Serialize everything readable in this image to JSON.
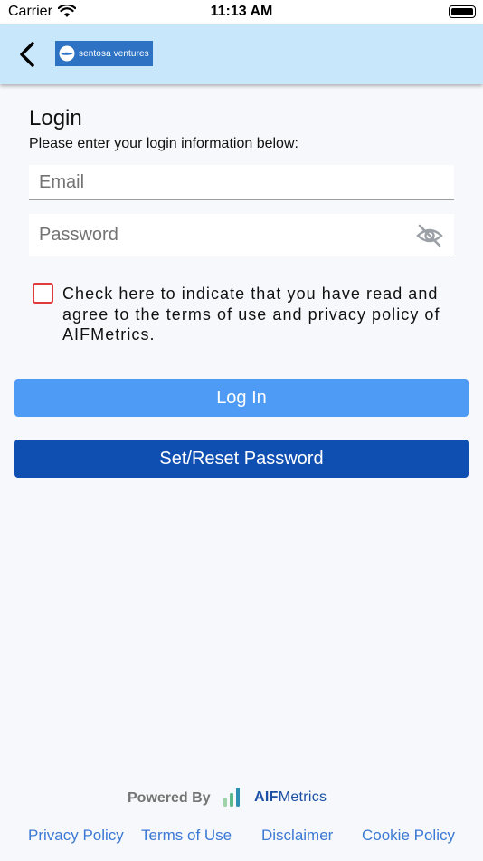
{
  "status_bar": {
    "carrier": "Carrier",
    "time": "11:13 AM"
  },
  "header": {
    "brand_name": "sentosa ventures",
    "back_icon": "chevron-left-icon",
    "background": "#c8e7fb"
  },
  "login": {
    "title": "Login",
    "subtitle": "Please enter your login information below:",
    "email_placeholder": "Email",
    "email_value": "",
    "password_placeholder": "Password",
    "password_value": "",
    "password_toggle_icon": "eye-off-icon",
    "terms_checked": false,
    "terms_text": "Check here to indicate that you have read and agree to the terms of use and privacy policy of AIFMetrics.",
    "login_button": "Log In",
    "reset_button": "Set/Reset Password"
  },
  "footer": {
    "powered_by": "Powered By",
    "brand_bold": "AIF",
    "brand_rest": "Metrics",
    "links": [
      "Privacy Policy",
      "Terms of Use",
      "Disclaimer",
      "Cookie Policy"
    ]
  },
  "colors": {
    "login_button": "#4e9bf5",
    "reset_button": "#0f4fb2",
    "checkbox_border": "#e23b3b",
    "link": "#3b79d4"
  }
}
